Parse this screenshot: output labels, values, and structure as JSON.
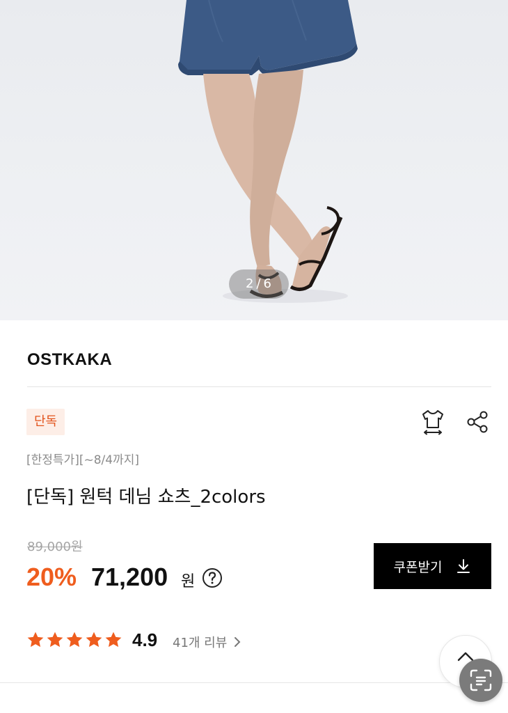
{
  "gallery": {
    "current": "2",
    "separator": "/",
    "total": "6"
  },
  "product": {
    "brand": "OSTKAKA",
    "badge": "단독",
    "promo": "[한정특가][~8/4까지]",
    "title": "[단독] 원턱 데님 쇼츠_2colors",
    "original_price": "89,000원",
    "discount": "20%",
    "price": "71,200",
    "currency": "원",
    "coupon_label": "쿠폰받기",
    "rating": "4.9",
    "review_count": "41개 리뷰",
    "stars_filled": 5
  },
  "icons": {
    "size_guide": "tshirt-size-icon",
    "share": "share-icon",
    "help": "question-circle-icon",
    "download": "download-icon",
    "chevron": "chevron-right-icon",
    "scroll_top": "chevron-up-icon",
    "scan": "scan-icon"
  },
  "colors": {
    "accent": "#ef5d1e",
    "badge_bg": "#fdeee7",
    "star": "#ef5d1e",
    "button_bg": "#000000"
  }
}
